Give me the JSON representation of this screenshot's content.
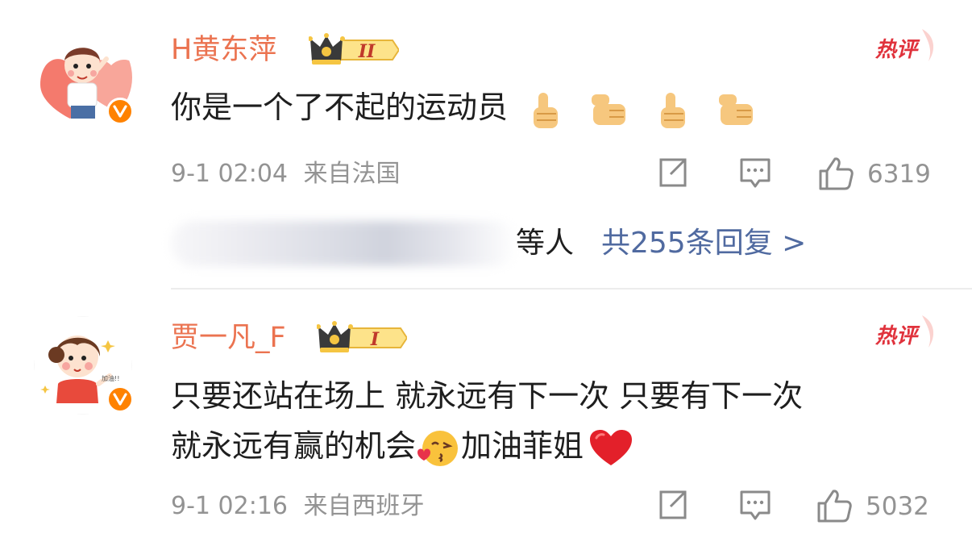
{
  "comments": [
    {
      "username": "H黄东萍",
      "level": "II",
      "hot_label": "热评",
      "text": "你是一个了不起的运动员",
      "text_icons": [
        "thumbs-up-icon",
        "thumbs-up-icon",
        "thumbs-up-icon",
        "thumbs-up-icon"
      ],
      "time": "9-1 02:04",
      "location": "来自法国",
      "likes": "6319",
      "replies_suffix": "等人",
      "replies_count": "共255条回复 >"
    },
    {
      "username": "贾一凡_F",
      "level": "I",
      "hot_label": "热评",
      "text_line1": "只要还站在场上 就永远有下一次 只要有下一次",
      "text_line2a": "就永远有赢的机会",
      "text_line2b": "加油菲姐",
      "text_icons": [
        "kiss-face-icon",
        "red-heart-icon"
      ],
      "time": "9-1 02:16",
      "location": "来自西班牙",
      "likes": "5032"
    }
  ],
  "colors": {
    "username": "#eb7350",
    "link": "#506aa0",
    "meta": "#939393",
    "verified": "#ff8200"
  }
}
